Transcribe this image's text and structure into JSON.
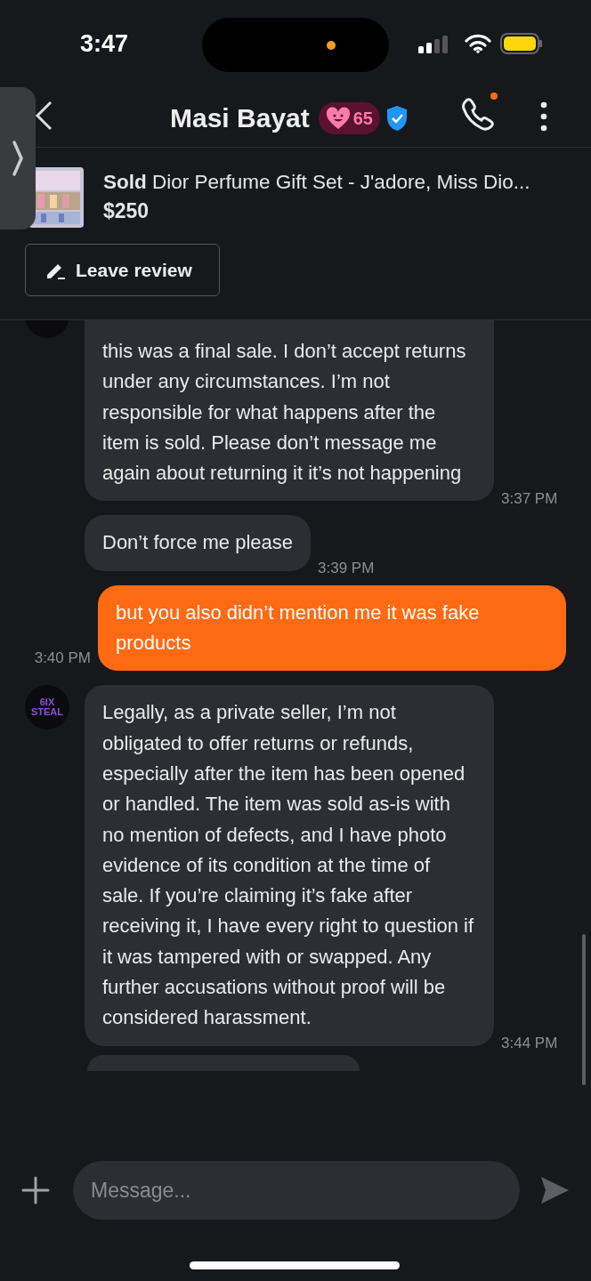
{
  "status_bar": {
    "time": "3:47"
  },
  "header": {
    "title": "Masi Bayat",
    "score": "65",
    "verified": true,
    "call_notification": true
  },
  "listing": {
    "status": "Sold",
    "title": "Dior Perfume Gift Set - J'adore, Miss Dio...",
    "price": "$250",
    "review_button": "Leave review"
  },
  "messages": [
    {
      "kind": "incoming",
      "avatar": true,
      "text": "this was a final sale. I don’t accept returns under any circumstances. I’m not responsible for what happens after the item is sold. Please don’t message me again about returning it it’s not happening",
      "time": "3:37 PM"
    },
    {
      "kind": "incoming",
      "avatar": false,
      "text": "Don’t force me please",
      "time": "3:39 PM"
    },
    {
      "kind": "outgoing",
      "text": "but you also didn’t mention me it was fake products",
      "time": "3:40 PM"
    },
    {
      "kind": "incoming",
      "avatar": true,
      "avatar_lines": [
        "6IX",
        "STEAL"
      ],
      "text": "Legally, as a private seller, I’m not obligated to offer returns or refunds, especially after the item has been opened or handled. The item was sold as-is with no mention of defects, and I have photo evidence of its condition at the time of sale. If you’re claiming it’s fake after receiving it, I have every right to question if it was tampered with or swapped. Any further accusations without proof will be considered harassment.",
      "time": "3:44 PM"
    }
  ],
  "composer": {
    "placeholder": "Message..."
  }
}
